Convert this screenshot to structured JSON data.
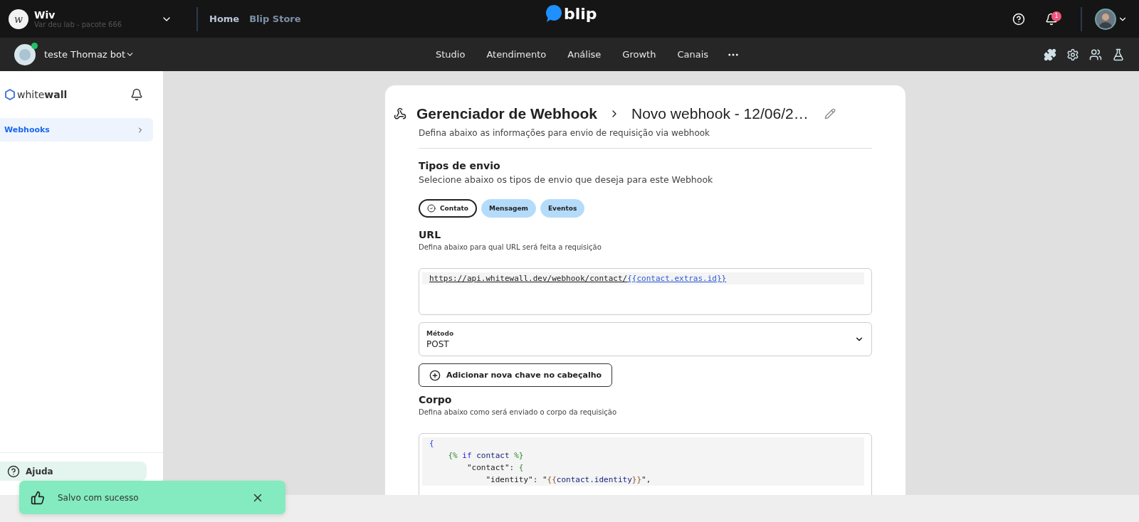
{
  "topbar": {
    "org": {
      "logo": "w",
      "name": "Wiv",
      "subtitle": "Var deu lab - pacote 666"
    },
    "nav": [
      {
        "label": "Home",
        "selected": true
      },
      {
        "label": "Blip Store",
        "selected": false
      }
    ],
    "brand": "blip",
    "notification_count": "1"
  },
  "botbar": {
    "bot_name": "teste Thomaz bot",
    "online": true,
    "menu": [
      "Studio",
      "Atendimento",
      "Análise",
      "Growth",
      "Canais"
    ]
  },
  "sidebar": {
    "brand": "white**wall**",
    "items": [
      {
        "label": "Webhooks",
        "selected": true
      }
    ],
    "help": "Ajuda"
  },
  "card": {
    "title": "Gerenciador de Webhook",
    "breadcrumb": "Novo webhook - 12/06/2…",
    "description": "Defina abaixo as informações para envio de requisição via webhook",
    "types": {
      "title": "Tipos de envio",
      "description": "Selecione abaixo os tipos de envio que deseja para este Webhook",
      "options": [
        {
          "label": "Contato",
          "selected": true
        },
        {
          "label": "Mensagem",
          "selected": false
        },
        {
          "label": "Eventos",
          "selected": false
        }
      ]
    },
    "url": {
      "title": "URL",
      "description": "Defina abaixo para qual URL será feita a requisição",
      "tokens": [
        {
          "text": "https://api.whitewall.dev/webhook/contact/",
          "kind": "plain"
        },
        {
          "text": "{{contact.extras.id}}",
          "kind": "variable"
        }
      ]
    },
    "method": {
      "label": "Método",
      "value": "POST"
    },
    "add_header_button": "Adicionar nova chave no cabeçalho",
    "body": {
      "title": "Corpo",
      "description": "Defina abaixo como será enviado o corpo da requisição",
      "lines": [
        [
          {
            "text": "{",
            "kind": "brace"
          }
        ],
        [
          {
            "text": "    {%",
            "kind": "tag"
          },
          {
            "text": " if",
            "kind": "keyword"
          },
          {
            "text": " contact",
            "kind": "variable"
          },
          {
            "text": " %}",
            "kind": "tag"
          }
        ],
        [
          {
            "text": "        \"contact\": ",
            "kind": "plain"
          },
          {
            "text": "{",
            "kind": "tag"
          }
        ],
        [
          {
            "text": "            \"identity\": \"",
            "kind": "plain"
          },
          {
            "text": "{{",
            "kind": "delim"
          },
          {
            "text": "contact.identity",
            "kind": "variable"
          },
          {
            "text": "}}",
            "kind": "delim"
          },
          {
            "text": "\",",
            "kind": "plain"
          }
        ]
      ]
    }
  },
  "toast": {
    "message": "Salvo com sucesso"
  }
}
